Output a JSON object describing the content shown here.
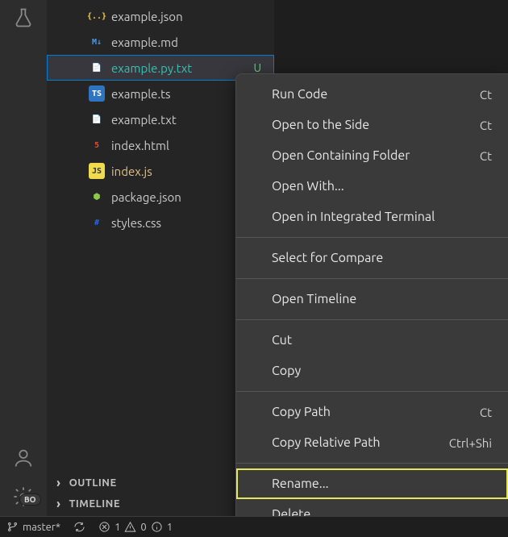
{
  "activitybar": {
    "badge": "BO"
  },
  "sidebar": {
    "files": [
      {
        "name": "example.json",
        "iconClass": "fi-json",
        "iconText": "{..}",
        "selected": false,
        "modified": false,
        "status": ""
      },
      {
        "name": "example.md",
        "iconClass": "fi-md",
        "iconText": "M↓",
        "selected": false,
        "modified": false,
        "status": ""
      },
      {
        "name": "example.py.txt",
        "iconClass": "fi-py",
        "iconText": "📄",
        "selected": true,
        "modified": false,
        "status": "U"
      },
      {
        "name": "example.ts",
        "iconClass": "fi-ts",
        "iconText": "TS",
        "selected": false,
        "modified": false,
        "status": ""
      },
      {
        "name": "example.txt",
        "iconClass": "fi-txt",
        "iconText": "📄",
        "selected": false,
        "modified": false,
        "status": ""
      },
      {
        "name": "index.html",
        "iconClass": "fi-html",
        "iconText": "5",
        "selected": false,
        "modified": false,
        "status": ""
      },
      {
        "name": "index.js",
        "iconClass": "fi-js",
        "iconText": "JS",
        "selected": false,
        "modified": true,
        "status": ""
      },
      {
        "name": "package.json",
        "iconClass": "fi-pkg",
        "iconText": "⬢",
        "selected": false,
        "modified": false,
        "status": ""
      },
      {
        "name": "styles.css",
        "iconClass": "fi-css",
        "iconText": "#",
        "selected": false,
        "modified": false,
        "status": ""
      }
    ],
    "panels": {
      "outline": "OUTLINE",
      "timeline": "TIMELINE"
    }
  },
  "context_menu": {
    "groups": [
      [
        {
          "label": "Run Code",
          "kbd": "Ct",
          "highlight": false
        },
        {
          "label": "Open to the Side",
          "kbd": "Ct",
          "highlight": false
        },
        {
          "label": "Open Containing Folder",
          "kbd": "Ct",
          "highlight": false
        },
        {
          "label": "Open With...",
          "kbd": "",
          "highlight": false
        },
        {
          "label": "Open in Integrated Terminal",
          "kbd": "",
          "highlight": false
        }
      ],
      [
        {
          "label": "Select for Compare",
          "kbd": "",
          "highlight": false
        }
      ],
      [
        {
          "label": "Open Timeline",
          "kbd": "",
          "highlight": false
        }
      ],
      [
        {
          "label": "Cut",
          "kbd": "",
          "highlight": false
        },
        {
          "label": "Copy",
          "kbd": "",
          "highlight": false
        }
      ],
      [
        {
          "label": "Copy Path",
          "kbd": "Ct",
          "highlight": false
        },
        {
          "label": "Copy Relative Path",
          "kbd": "Ctrl+Shi",
          "highlight": false
        }
      ],
      [
        {
          "label": "Rename...",
          "kbd": "",
          "highlight": true
        },
        {
          "label": "Delete",
          "kbd": "",
          "highlight": false
        }
      ]
    ]
  },
  "statusbar": {
    "branch": "master*",
    "sync_icon": "sync",
    "errors": "1",
    "warnings": "0",
    "info": "1"
  }
}
